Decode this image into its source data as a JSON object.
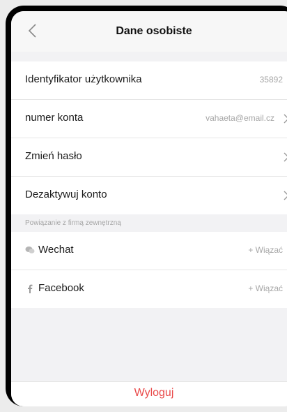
{
  "header": {
    "title": "Dane osobiste"
  },
  "account": {
    "rows": [
      {
        "label": "Identyfikator użytkownika",
        "value": "35892",
        "chevron": false
      },
      {
        "label": "numer konta",
        "value": "vahaeta@email.cz",
        "chevron": true
      },
      {
        "label": "Zmień hasło",
        "value": "",
        "chevron": true
      },
      {
        "label": "Dezaktywuj konto",
        "value": "",
        "chevron": true
      }
    ]
  },
  "third_party": {
    "section_title": "Powiązanie z firmą zewnętrzną",
    "rows": [
      {
        "icon": "wechat-icon",
        "label": "Wechat",
        "action": "+ Wiązać"
      },
      {
        "icon": "facebook-icon",
        "label": "Facebook",
        "action": "+ Wiązać"
      }
    ]
  },
  "footer": {
    "logout_label": "Wyloguj"
  },
  "colors": {
    "accent": "#e94a4a",
    "muted": "#a6a6a6"
  }
}
